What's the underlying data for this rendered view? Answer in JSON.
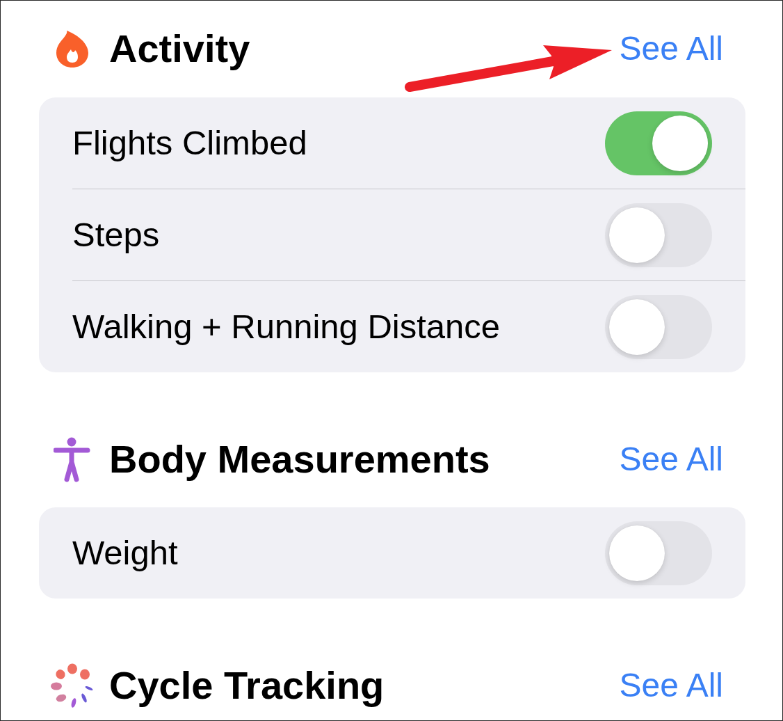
{
  "sections": [
    {
      "kind": "activity",
      "title": "Activity",
      "see_all": "See All",
      "arrow_to_see_all": true,
      "items": [
        {
          "label": "Flights Climbed",
          "on": true
        },
        {
          "label": "Steps",
          "on": false
        },
        {
          "label": "Walking + Running Distance",
          "on": false
        }
      ]
    },
    {
      "kind": "body",
      "title": "Body Measurements",
      "see_all": "See All",
      "arrow_to_see_all": false,
      "items": [
        {
          "label": "Weight",
          "on": false
        }
      ]
    },
    {
      "kind": "cycle",
      "title": "Cycle Tracking",
      "see_all": "See All",
      "arrow_to_see_all": false
    }
  ]
}
